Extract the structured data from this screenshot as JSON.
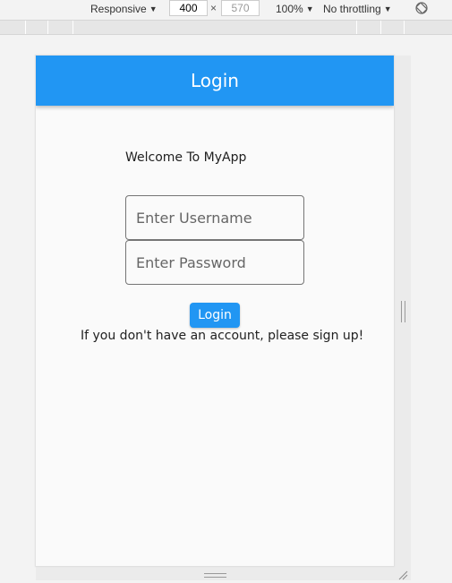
{
  "devtools": {
    "device_mode": "Responsive",
    "width": "400",
    "height": "570",
    "dimension_separator": "×",
    "zoom": "100%",
    "throttling": "No throttling",
    "caret": "▼"
  },
  "app": {
    "title": "Login",
    "welcome_text": "Welcome To MyApp",
    "username_placeholder": "Enter Username",
    "password_placeholder": "Enter Password",
    "login_button_label": "Login",
    "signup_text": "If you don't have an account, please sign up!",
    "accent_color": "#2196f3"
  }
}
